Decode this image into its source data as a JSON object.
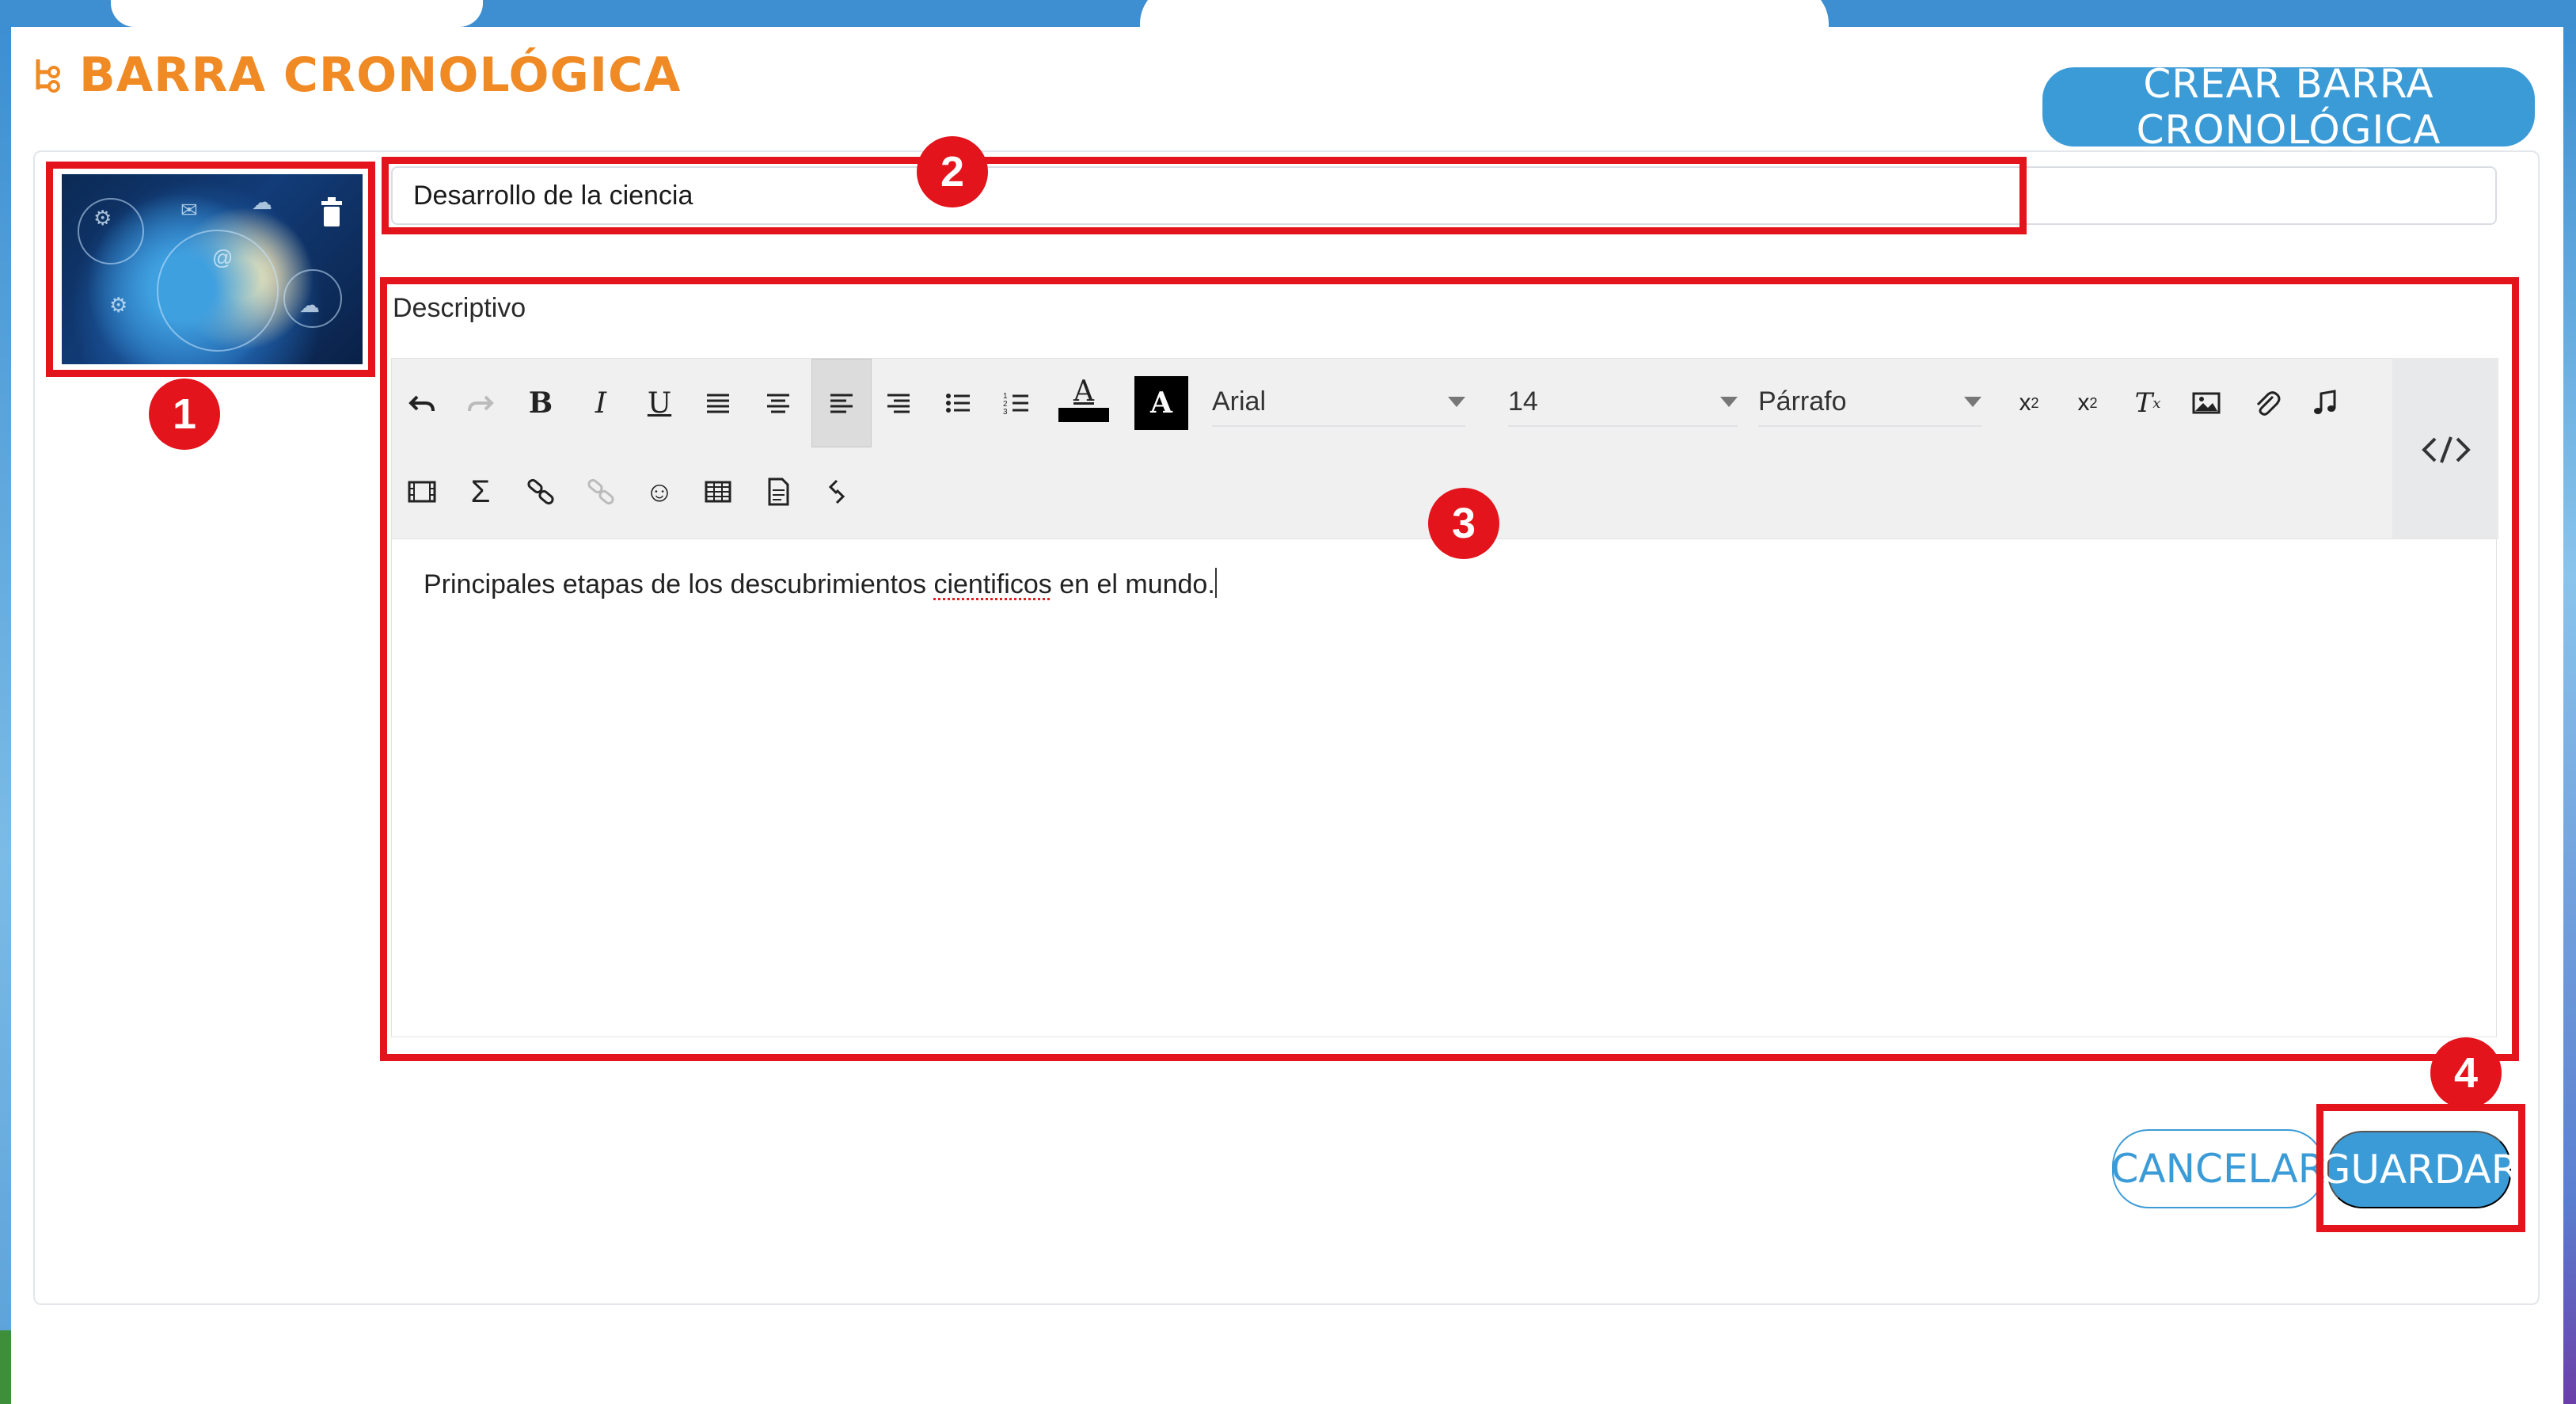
{
  "header": {
    "title": "BARRA CRONOLÓGICA",
    "create_button": "CREAR BARRA CRONOLÓGICA"
  },
  "form": {
    "title_value": "Desarrollo de la ciencia",
    "description_label": "Descriptivo",
    "description_text_before": "Principales etapas de los descubrimientos ",
    "description_text_misspelled": "cientificos",
    "description_text_after": " en el mundo."
  },
  "toolbar": {
    "font_family": "Arial",
    "font_size": "14",
    "block_format": "Párrafo",
    "icons": [
      "undo-icon",
      "redo-icon",
      "bold-icon",
      "italic-icon",
      "underline-icon",
      "justify-icon",
      "align-center-icon",
      "align-left-icon",
      "align-right-icon",
      "bullet-list-icon",
      "numbered-list-icon",
      "text-color-icon",
      "background-color-icon",
      "subscript-icon",
      "superscript-icon",
      "clear-format-icon",
      "image-icon",
      "attachment-icon",
      "audio-icon",
      "source-code-icon",
      "video-icon",
      "sigma-icon",
      "link-icon",
      "unlink-icon",
      "emoji-icon",
      "table-icon",
      "template-icon",
      "fullscreen-icon"
    ]
  },
  "actions": {
    "cancel": "CANCELAR",
    "save": "GUARDAR"
  },
  "annotations": [
    "1",
    "2",
    "3",
    "4"
  ],
  "colors": {
    "accent": "#3b9bd7",
    "title": "#f08a24",
    "highlight": "#e3141b"
  }
}
